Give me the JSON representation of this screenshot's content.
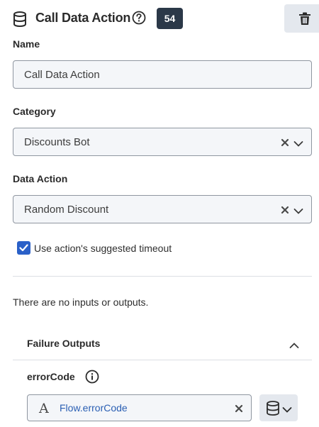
{
  "header": {
    "title": "Call Data Action",
    "count_badge": "54",
    "icon": "database-icon",
    "help_icon": "question-circle-icon",
    "delete_icon": "trash-icon"
  },
  "form": {
    "name": {
      "label": "Name",
      "value": "Call Data Action"
    },
    "category": {
      "label": "Category",
      "value": "Discounts Bot"
    },
    "data_action": {
      "label": "Data Action",
      "value": "Random Discount"
    },
    "timeout_checkbox": {
      "label": "Use action's suggested timeout",
      "checked": true
    },
    "no_io_message": "There are no inputs or outputs."
  },
  "failure_outputs": {
    "title": "Failure Outputs",
    "expanded": true,
    "fields": [
      {
        "label": "errorCode",
        "type_icon": "text-type-icon",
        "value": "Flow.errorCode"
      }
    ]
  },
  "colors": {
    "accent": "#2a60c8",
    "badge_bg": "#2b3848",
    "variable_text": "#2a5fb3",
    "field_bg": "#f4f6f9",
    "button_bg": "#e4e8ee"
  }
}
